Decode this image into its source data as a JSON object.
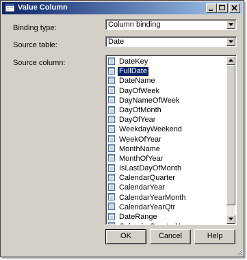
{
  "window": {
    "title": "Value Column",
    "icon": "dialog-app-icon",
    "controls": [
      "minimize-icon",
      "maximize-icon",
      "close-icon"
    ]
  },
  "form": {
    "binding_type": {
      "label": "Binding type:",
      "value": "Column binding"
    },
    "source_table": {
      "label": "Source table:",
      "value": "Date"
    },
    "source_column": {
      "label": "Source column:"
    }
  },
  "columns": [
    "DateKey",
    "FullDate",
    "DateName",
    "DayOfWeek",
    "DayNameOfWeek",
    "DayOfMonth",
    "DayOfYear",
    "WeekdayWeekend",
    "WeekOfYear",
    "MonthName",
    "MonthOfYear",
    "IsLastDayOfMonth",
    "CalendarQuarter",
    "CalendarYear",
    "CalendarYearMonth",
    "CalendarYearQtr",
    "DateRange",
    "CalendarQuarterName"
  ],
  "selected_column": "FullDate",
  "buttons": {
    "ok": "OK",
    "cancel": "Cancel",
    "help": "Help"
  },
  "colors": {
    "titlebar_start": "#0a246a",
    "titlebar_end": "#a6caf0",
    "face": "#d4d0c8",
    "selection": "#0a246a"
  }
}
